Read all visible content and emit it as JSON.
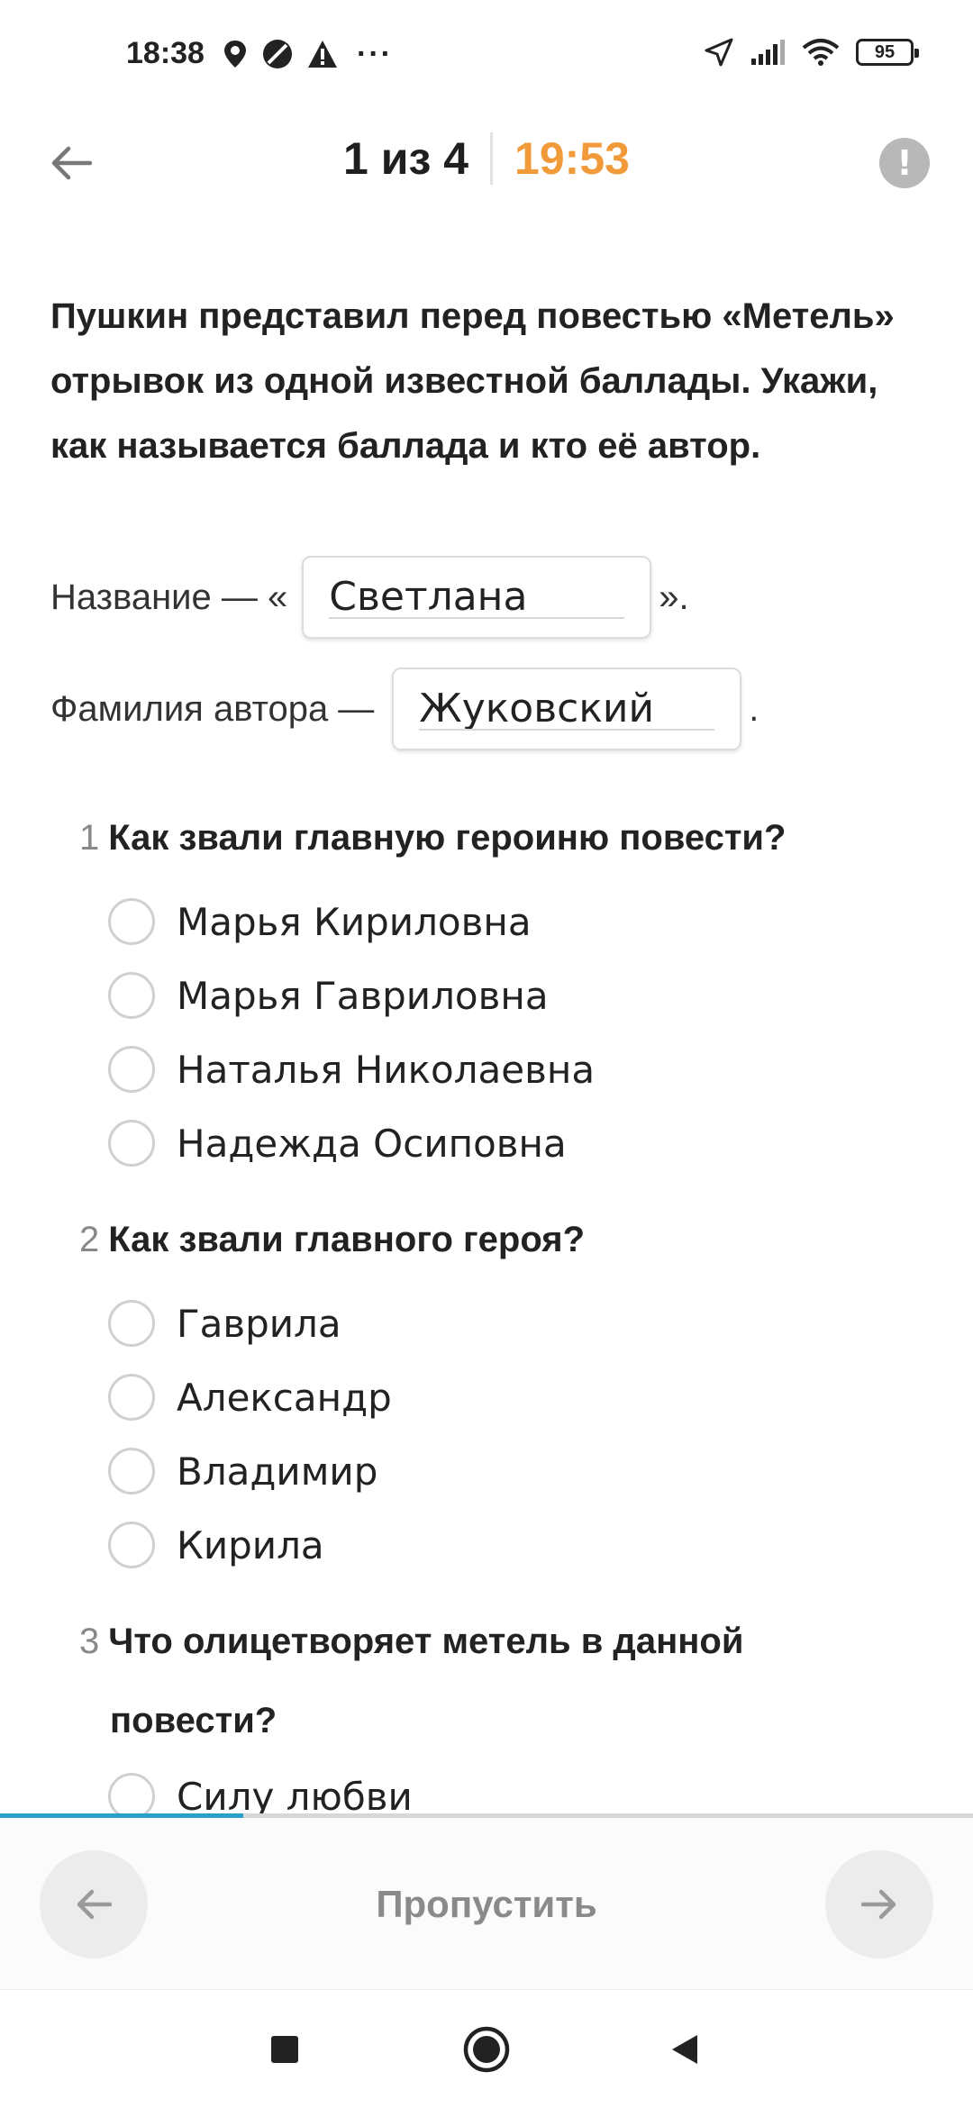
{
  "status_bar": {
    "time": "18:38",
    "battery": "95",
    "icons": [
      "location-pin-icon",
      "data-saver-icon",
      "warning-icon",
      "more-dots-icon",
      "location-arrow-icon",
      "signal-icon",
      "wifi-icon",
      "battery-icon"
    ]
  },
  "header": {
    "progress": "1 из 4",
    "timer": "19:53",
    "timer_color": "#f09a3a"
  },
  "question": {
    "text": "Пушкин представил перед повестью «Метель» отрывок из одной известной баллады. Укажи, как называется баллада и кто её автор.",
    "title_prefix": "Название — «",
    "title_value": "Светлана",
    "title_suffix": "».",
    "author_prefix": "Фамилия автора —",
    "author_value": "Жуковский",
    "author_suffix": "."
  },
  "subquestions": [
    {
      "number": "1",
      "text": "Как звали главную героиню повести?",
      "options": [
        "Марья Кириловна",
        "Марья Гавриловна",
        "Наталья Николаевна",
        "Надежда Осиповна"
      ]
    },
    {
      "number": "2",
      "text": "Как звали главного героя?",
      "options": [
        "Гаврила",
        "Александр",
        "Владимир",
        "Кирила"
      ]
    },
    {
      "number": "3",
      "text_line1": "Что олицетворяет метель в данной",
      "text_line2": "повести?",
      "options": [
        "Силу любви"
      ]
    }
  ],
  "progress_fraction": 0.25,
  "progress_color": "#2aa0c8",
  "footer": {
    "skip_label": "Пропустить"
  }
}
